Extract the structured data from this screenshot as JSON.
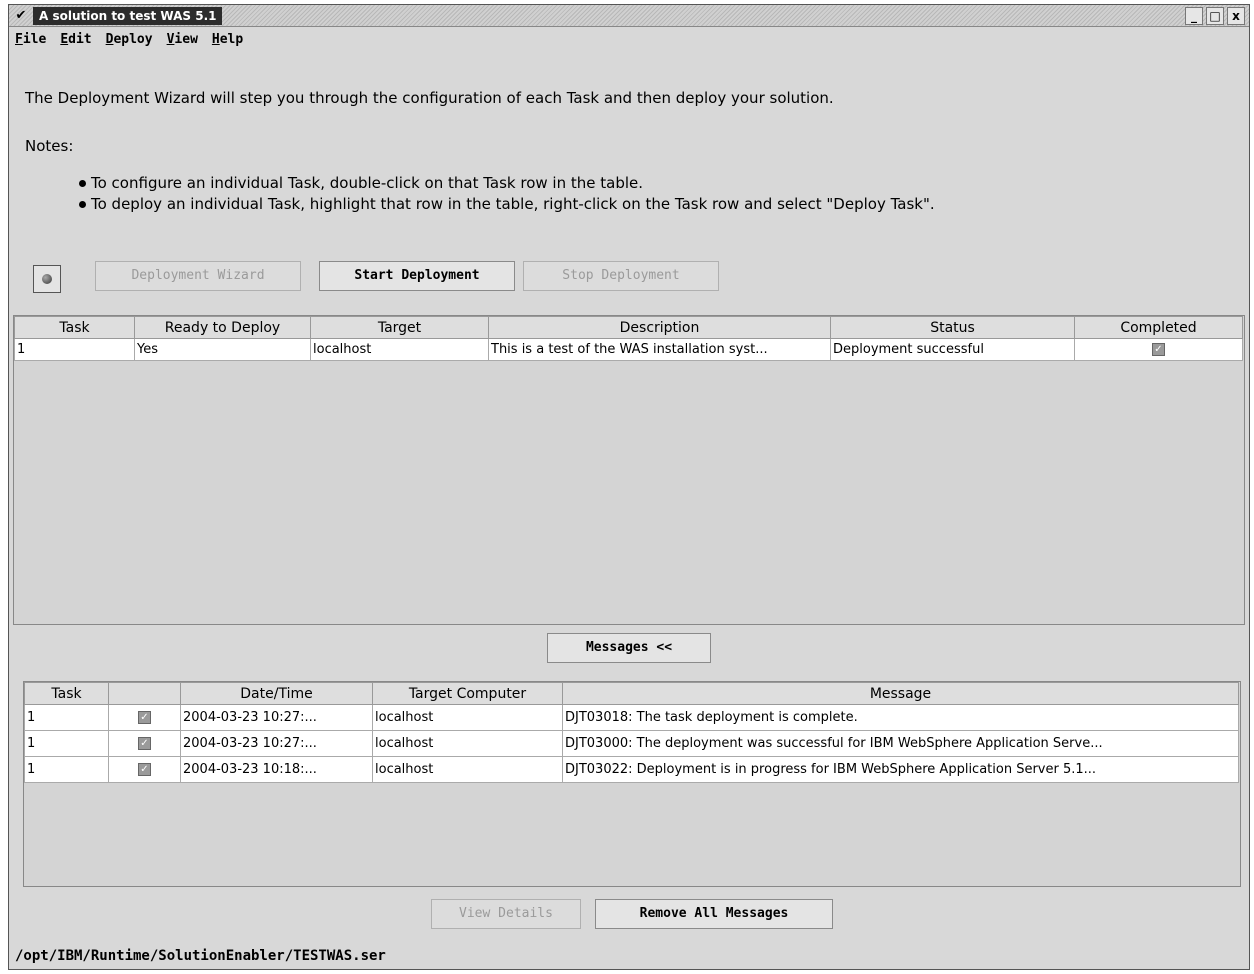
{
  "window": {
    "title": "A solution to test WAS 5.1",
    "min": "_",
    "max": "□",
    "close": "x"
  },
  "menu": [
    "File",
    "Edit",
    "Deploy",
    "View",
    "Help"
  ],
  "intro": "The Deployment Wizard will step you through the configuration of each Task and then deploy your solution.",
  "notes": {
    "label": "Notes:",
    "items": [
      "To configure an individual Task, double-click on that Task row in the table.",
      "To deploy an individual Task, highlight that row in the table, right-click on the Task row and select \"Deploy Task\"."
    ]
  },
  "toolbar": {
    "wizard": "Deployment Wizard",
    "start": "Start Deployment",
    "stop": "Stop Deployment"
  },
  "tasks": {
    "columns": [
      "Task",
      "Ready to Deploy",
      "Target",
      "Description",
      "Status",
      "Completed"
    ],
    "rows": [
      {
        "task": "1",
        "ready": "Yes",
        "target": "localhost",
        "description": "This is a test of the WAS installation syst...",
        "status": "Deployment successful",
        "completed": true
      }
    ]
  },
  "messages_toggle": "Messages <<",
  "messages": {
    "columns": [
      "Task",
      "",
      "Date/Time",
      "Target Computer",
      "Message"
    ],
    "rows": [
      {
        "task": "1",
        "ok": true,
        "datetime": "2004-03-23 10:27:...",
        "target": "localhost",
        "message": "DJT03018: The task deployment is complete."
      },
      {
        "task": "1",
        "ok": true,
        "datetime": "2004-03-23 10:27:...",
        "target": "localhost",
        "message": "DJT03000: The deployment was successful for IBM WebSphere Application Serve..."
      },
      {
        "task": "1",
        "ok": true,
        "datetime": "2004-03-23 10:18:...",
        "target": "localhost",
        "message": "DJT03022: Deployment is in progress for IBM WebSphere Application Server 5.1..."
      }
    ]
  },
  "bottom": {
    "view_details": "View Details",
    "remove_all": "Remove All Messages"
  },
  "status_path": "/opt/IBM/Runtime/SolutionEnabler/TESTWAS.ser"
}
